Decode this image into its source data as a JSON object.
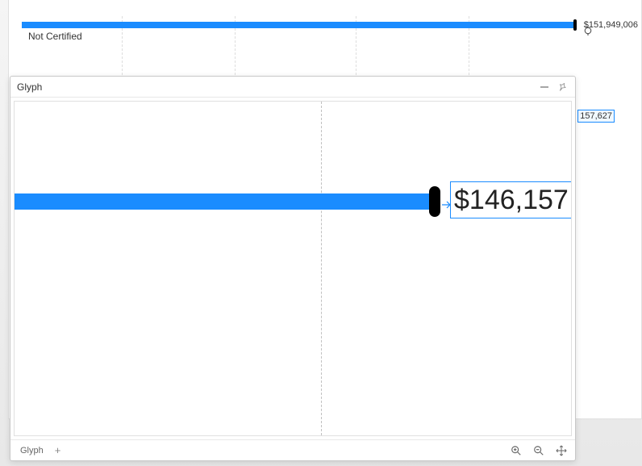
{
  "background": {
    "row_label": "Not Certified",
    "bar_value_label": "$151,949,006",
    "lower_value_label": "157,627"
  },
  "glyph_panel": {
    "title": "Glyph",
    "preview_value": "$146,157",
    "footer_tab": "Glyph"
  },
  "colors": {
    "bar": "#1a8cff",
    "marker": "#000000"
  },
  "chart_data": {
    "type": "bar",
    "orientation": "horizontal",
    "title": "",
    "xlabel": "",
    "ylabel": "",
    "categories": [
      "Not Certified"
    ],
    "values": [
      151949006
    ],
    "data_labels": [
      "$151,949,006"
    ],
    "ylim": [
      0,
      160000000
    ],
    "glyph_preview_value": 146157
  }
}
